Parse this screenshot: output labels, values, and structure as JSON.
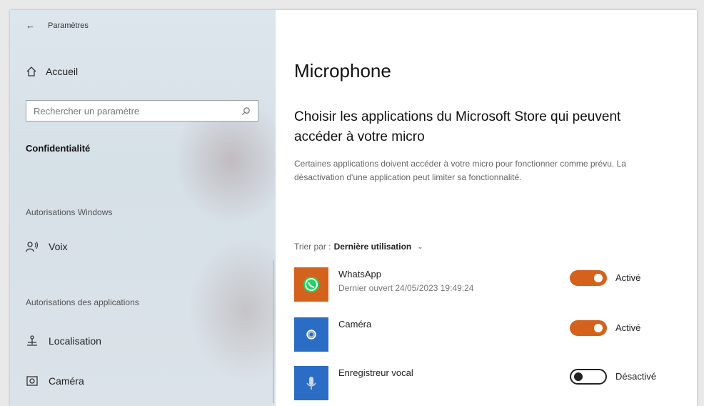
{
  "window": {
    "title": "Paramètres"
  },
  "sidebar": {
    "home_label": "Accueil",
    "search_placeholder": "Rechercher un paramètre",
    "section_title": "Confidentialité",
    "group_windows": "Autorisations Windows",
    "voice_label": "Voix",
    "group_apps": "Autorisations des applications",
    "location_label": "Localisation",
    "camera_label": "Caméra"
  },
  "main": {
    "title": "Microphone",
    "subheading": "Choisir les applications du Microsoft Store qui peuvent accéder à votre micro",
    "description": "Certaines applications doivent accéder à votre micro pour fonctionner comme prévu. La désactivation d'une application peut limiter sa fonctionnalité.",
    "sort_prefix": "Trier par :",
    "sort_value": "Dernière utilisation",
    "apps": [
      {
        "name": "WhatsApp",
        "sub": "Dernier ouvert 24/05/2023 19:49:24",
        "state": "Activé",
        "on": true,
        "icon": "whatsapp-icon"
      },
      {
        "name": "Caméra",
        "sub": "",
        "state": "Activé",
        "on": true,
        "icon": "camera-app-icon"
      },
      {
        "name": "Enregistreur vocal",
        "sub": "",
        "state": "Désactivé",
        "on": false,
        "icon": "voice-recorder-icon"
      }
    ]
  },
  "colors": {
    "accent": "#d4621d",
    "whatsapp_tile": "#d4621d",
    "app_tile": "#2b6cc4"
  }
}
